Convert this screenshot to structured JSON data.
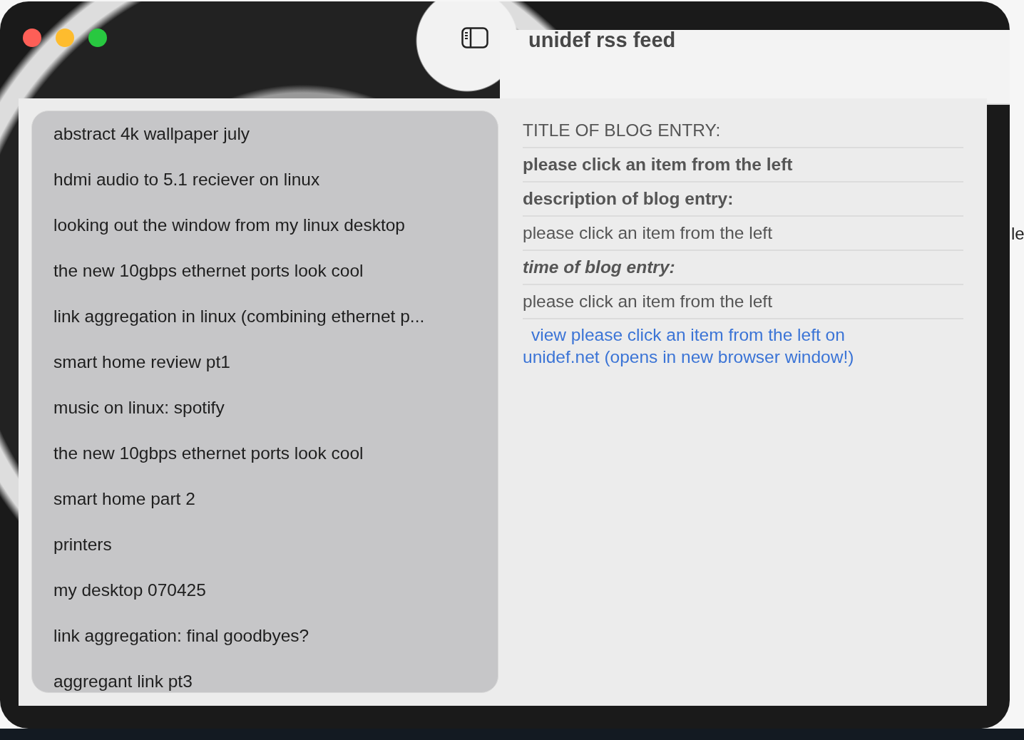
{
  "window": {
    "title": "unidef rss feed"
  },
  "sidebar": {
    "items": [
      {
        "label": "abstract 4k wallpaper july"
      },
      {
        "label": "hdmi audio to 5.1 reciever on linux"
      },
      {
        "label": "looking out the window from my linux desktop"
      },
      {
        "label": "the new 10gbps ethernet ports look cool"
      },
      {
        "label": "link aggregation in linux (combining ethernet p..."
      },
      {
        "label": "smart home review pt1"
      },
      {
        "label": "music on linux: spotify"
      },
      {
        "label": "the new 10gbps ethernet ports look cool"
      },
      {
        "label": "smart home part 2"
      },
      {
        "label": "printers"
      },
      {
        "label": "my desktop 070425"
      },
      {
        "label": "link aggregation: final goodbyes?"
      },
      {
        "label": "aggregant link pt3"
      }
    ]
  },
  "detail": {
    "rows": [
      {
        "kind": "plain",
        "text": "TITLE OF BLOG ENTRY:"
      },
      {
        "kind": "bold",
        "text": "please click an item from the left"
      },
      {
        "kind": "bold",
        "text": "description of blog entry:"
      },
      {
        "kind": "plain",
        "text": "please click an item from the left"
      },
      {
        "kind": "bold-italic",
        "text": "time of blog entry:"
      },
      {
        "kind": "plain",
        "text": "please click an item from the left"
      },
      {
        "kind": "link",
        "text": "view please click an item from the left on unidef.net (opens in new browser window!)"
      }
    ]
  },
  "background_window": {
    "text": "le"
  }
}
